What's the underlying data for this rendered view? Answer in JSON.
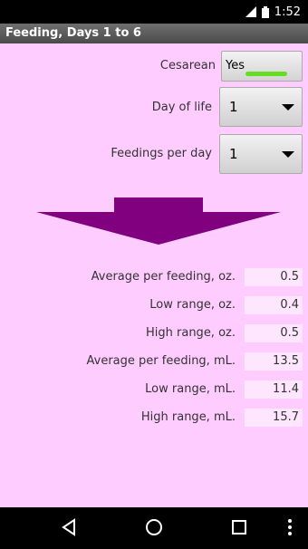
{
  "status_bar": {
    "time": "1:52"
  },
  "title": "Feeding, Days 1 to 6",
  "cesarean": {
    "label": "Cesarean",
    "value": "Yes"
  },
  "day_of_life": {
    "label": "Day of life",
    "value": "1"
  },
  "feedings_per_day": {
    "label": "Feedings per day",
    "value": "1"
  },
  "results": [
    {
      "label": "Average per feeding, oz.",
      "value": "0.5"
    },
    {
      "label": "Low range, oz.",
      "value": "0.4"
    },
    {
      "label": "High range, oz.",
      "value": "0.5"
    },
    {
      "label": "Average per feeding, mL.",
      "value": "13.5"
    },
    {
      "label": "Low range, mL.",
      "value": "11.4"
    },
    {
      "label": "High range, mL.",
      "value": "15.7"
    }
  ],
  "colors": {
    "background": "#ffccff",
    "arrow": "#800080",
    "toggle_on": "#66dd22"
  },
  "icons": {
    "signal": "signal-icon",
    "battery": "battery-icon",
    "back": "back-icon",
    "home": "home-icon",
    "recents": "recents-icon",
    "menu": "overflow-menu-icon"
  }
}
